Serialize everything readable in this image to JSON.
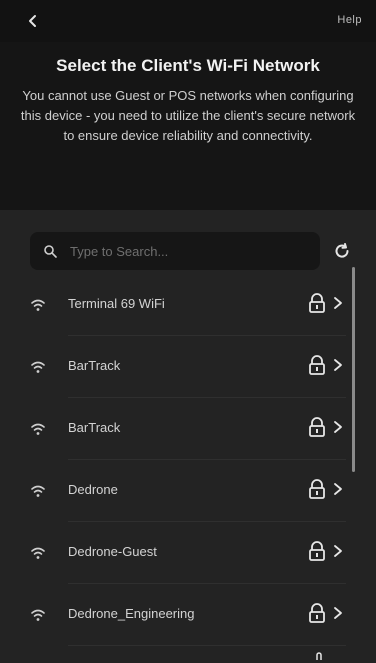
{
  "header": {
    "help": "Help",
    "title": "Select the Client's Wi-Fi Network",
    "subtitle": "You cannot use Guest or POS networks when configuring this device - you need to utilize the client's secure network to ensure device reliability and connectivity."
  },
  "search": {
    "placeholder": "Type to Search..."
  },
  "networks": [
    {
      "label": "Terminal 69 WiFi"
    },
    {
      "label": "BarTrack"
    },
    {
      "label": "BarTrack"
    },
    {
      "label": "Dedrone"
    },
    {
      "label": "Dedrone-Guest"
    },
    {
      "label": "Dedrone_Engineering"
    }
  ],
  "icons": {
    "back": "back-arrow-icon",
    "search": "search-icon",
    "refresh": "refresh-icon",
    "wifi": "wifi-icon",
    "lock": "lock-icon",
    "chevron": "chevron-right-icon"
  },
  "colors": {
    "background": "#121212",
    "list_background": "#232323",
    "text": "#e6e6e6"
  }
}
